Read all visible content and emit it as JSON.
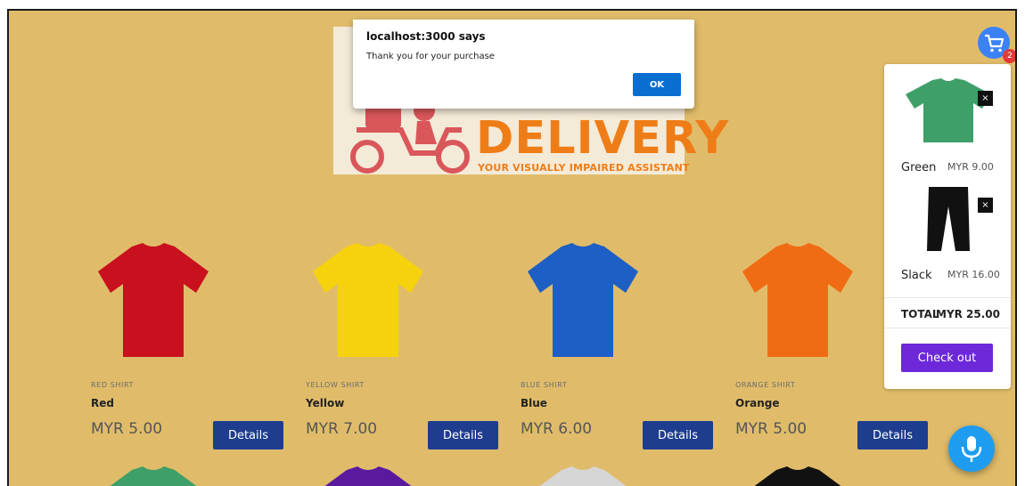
{
  "alert": {
    "title": "localhost:3000 says",
    "message": "Thank you for your purchase",
    "ok_label": "OK"
  },
  "banner": {
    "word": "DELIVERY",
    "tagline": "YOUR VISUALLY IMPAIRED ASSISTANT"
  },
  "products": [
    {
      "sku": "RED SHIRT",
      "name": "Red",
      "price": "MYR 5.00",
      "details_label": "Details",
      "color": "#c8101e"
    },
    {
      "sku": "YELLOW SHIRT",
      "name": "Yellow",
      "price": "MYR 7.00",
      "details_label": "Details",
      "color": "#f6d20c"
    },
    {
      "sku": "BLUE SHIRT",
      "name": "Blue",
      "price": "MYR 6.00",
      "details_label": "Details",
      "color": "#1d5fc4"
    },
    {
      "sku": "ORANGE SHIRT",
      "name": "Orange",
      "price": "MYR 5.00",
      "details_label": "Details",
      "color": "#f06c14"
    }
  ],
  "next_row_colors": [
    "#3e9f68",
    "#5b1a9e",
    "#d6d6d6",
    "#111111"
  ],
  "cart": {
    "count": "2",
    "items": [
      {
        "name": "Green",
        "price": "MYR 9.00",
        "remove_label": "×",
        "kind": "shirt",
        "color": "#3e9f68"
      },
      {
        "name": "Slack",
        "price": "MYR 16.00",
        "remove_label": "×",
        "kind": "pants",
        "color": "#111111"
      }
    ],
    "total_label": "TOTAL",
    "total_value": "MYR 25.00",
    "checkout_label": "Check out"
  },
  "icons": {
    "cart": "cart-icon",
    "mic": "microphone-icon"
  },
  "colors": {
    "page_background": "#e0bc6a",
    "details_button": "#1e3d8f",
    "checkout_button": "#6d28d9",
    "alert_ok": "#0a6ed1",
    "cart_button": "#3b82f6",
    "mic_button": "#1e9cf0"
  }
}
